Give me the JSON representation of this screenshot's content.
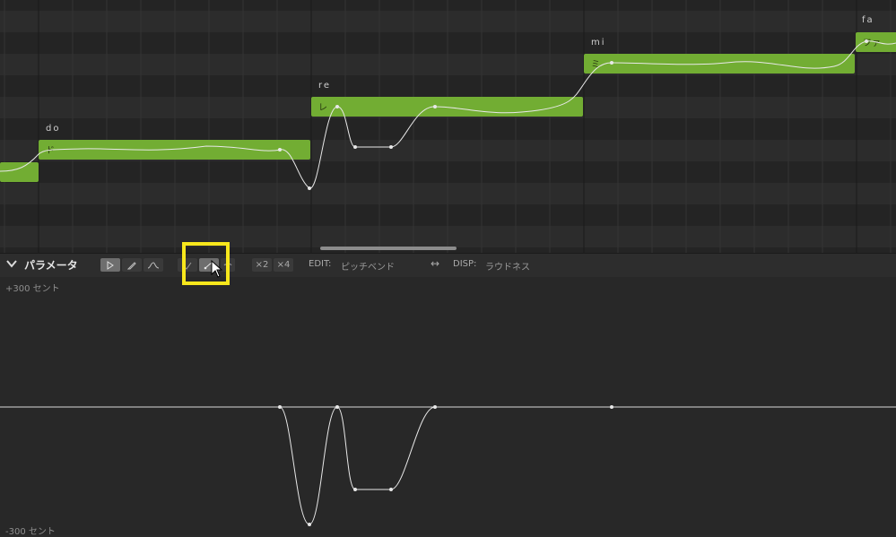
{
  "notes": [
    {
      "lyric": "do",
      "phoneme": "ド"
    },
    {
      "lyric": "re",
      "phoneme": "レ"
    },
    {
      "lyric": "mi",
      "phoneme": "ミ"
    },
    {
      "lyric": "fa",
      "phoneme": "ファ"
    }
  ],
  "toolbar": {
    "panel_title": "パラメータ",
    "zoom_x2": "×2",
    "zoom_x4": "×4",
    "edit_label": "EDIT:",
    "edit_value": "ピッチベンド",
    "swap_icon": "↔",
    "disp_label": "DISP:",
    "disp_value": "ラウドネス"
  },
  "param_panel": {
    "max_label": "+300 セント",
    "min_label": "-300 セント"
  },
  "colors": {
    "note_fill": "#72ad33",
    "highlight": "#f8e71c"
  }
}
